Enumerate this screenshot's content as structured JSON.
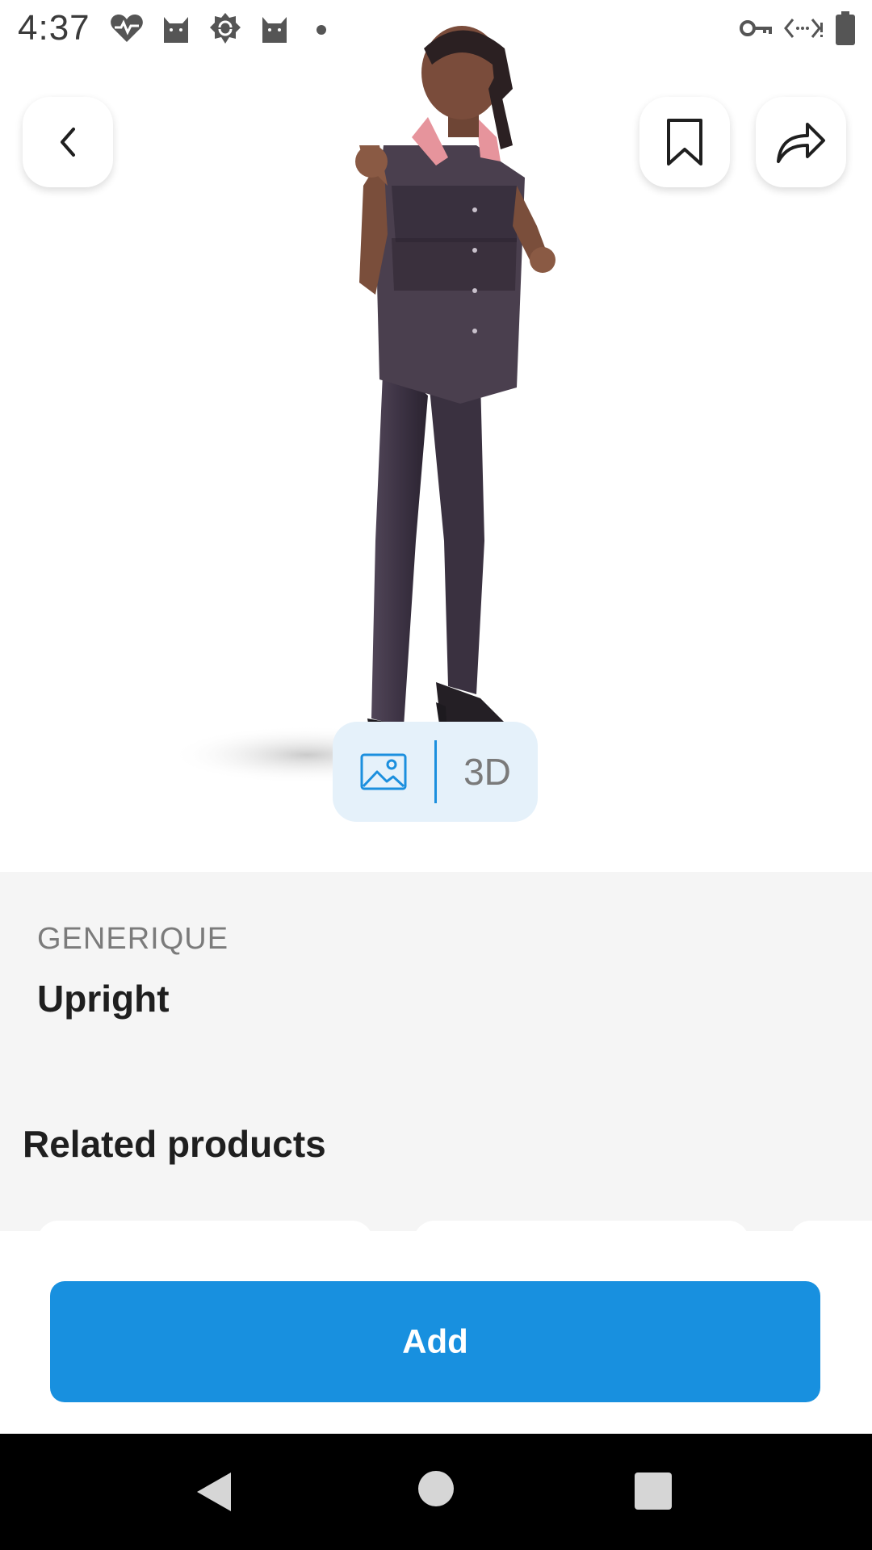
{
  "status_bar": {
    "time": "4:37",
    "left_icons": [
      "health-heart-icon",
      "cat-icon",
      "sync-badge-icon",
      "cat-icon",
      "dot-icon"
    ],
    "right_icons": [
      "vpn-key-icon",
      "data-saver-icon",
      "battery-icon"
    ]
  },
  "hero": {
    "image_subject": "3d-figure-standing-woman",
    "view_toggle": {
      "image_option": "image-icon",
      "three_d_label": "3D",
      "active": "image"
    }
  },
  "product": {
    "brand": "GENERIQUE",
    "name": "Upright"
  },
  "related": {
    "title": "Related products"
  },
  "actions": {
    "add_label": "Add",
    "accent": "#1890DF"
  },
  "navigation": {
    "buttons": [
      "back-triangle-icon",
      "home-circle-icon",
      "recents-square-icon"
    ]
  }
}
